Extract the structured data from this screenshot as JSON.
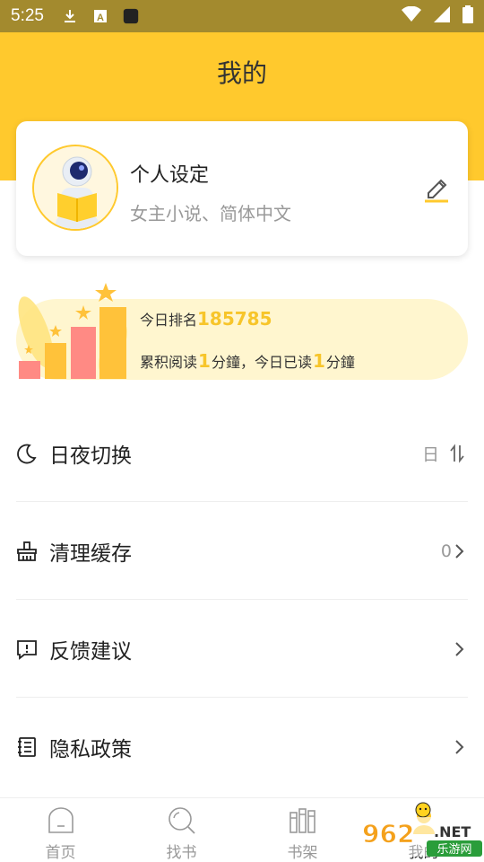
{
  "status_bar": {
    "time": "5:25"
  },
  "header": {
    "title": "我的"
  },
  "profile": {
    "name": "个人设定",
    "subtitle": "女主小说、简体中文"
  },
  "ranking": {
    "today_rank_label": "今日排名",
    "today_rank_value": "185785",
    "total_prefix": "累积阅读",
    "total_value": "1",
    "total_unit": "分鐘，今日已读",
    "today_value": "1",
    "today_unit": "分鐘"
  },
  "menu": [
    {
      "label": "日夜切换",
      "value": "日"
    },
    {
      "label": "清理缓存",
      "value": "0"
    },
    {
      "label": "反馈建议"
    },
    {
      "label": "隐私政策"
    }
  ],
  "tabs": [
    {
      "label": "首页"
    },
    {
      "label": "找书"
    },
    {
      "label": "书架"
    },
    {
      "label": "我的"
    }
  ],
  "watermark": {
    "number": "962",
    "net": ".NET",
    "site": "乐游网"
  },
  "colors": {
    "accent": "#ffc92d",
    "status_bar": "#a38a2e",
    "rank_highlight": "#f7c52a"
  }
}
